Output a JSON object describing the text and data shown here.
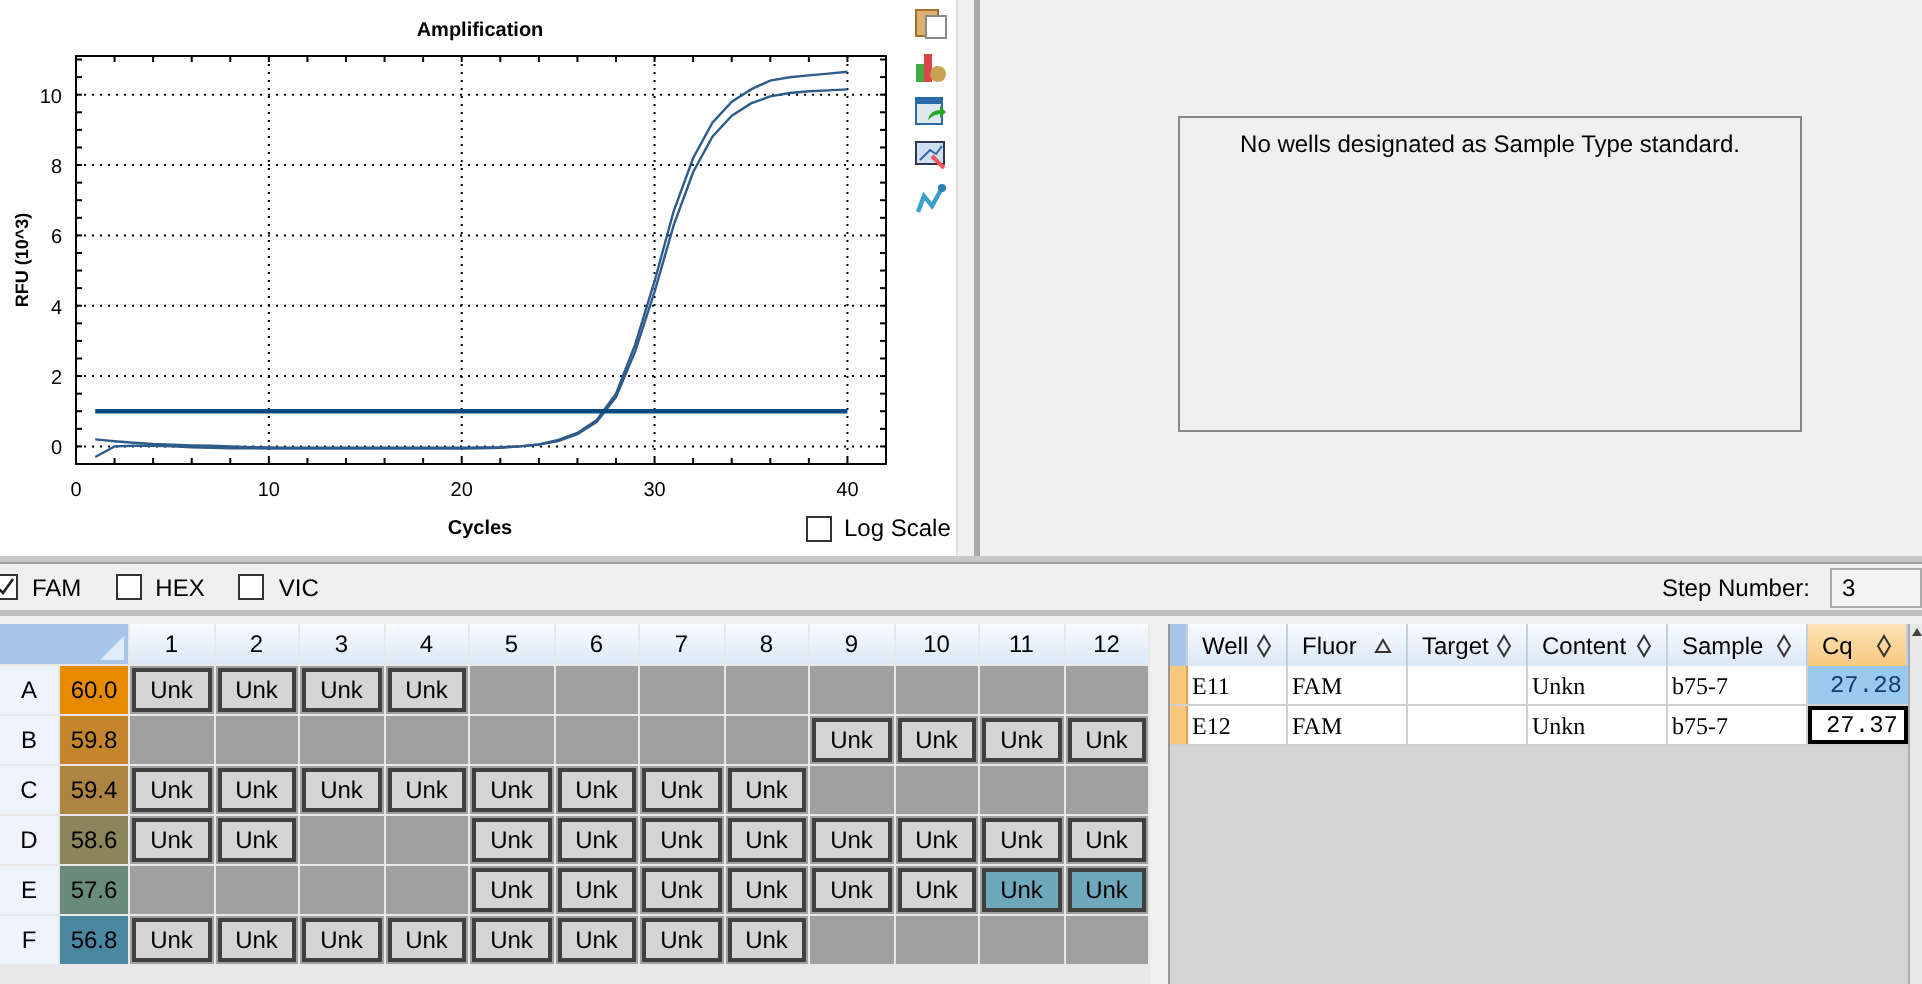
{
  "chart": {
    "chart_data": {
      "type": "line",
      "title": "Amplification",
      "xlabel": "Cycles",
      "ylabel": "RFU (10^3)",
      "x": [
        1,
        2,
        3,
        4,
        5,
        6,
        7,
        8,
        9,
        10,
        11,
        12,
        13,
        14,
        15,
        16,
        17,
        18,
        19,
        20,
        21,
        22,
        23,
        24,
        25,
        26,
        27,
        28,
        29,
        30,
        31,
        32,
        33,
        34,
        35,
        36,
        37,
        38,
        39,
        40
      ],
      "xlim": [
        0,
        42
      ],
      "ylim": [
        -0.5,
        11.1
      ],
      "xticks": [
        0,
        10,
        20,
        30,
        40
      ],
      "yticks": [
        0,
        2,
        4,
        6,
        8,
        10
      ],
      "grid": true,
      "series": [
        {
          "color": "#2e5c8a",
          "values": [
            -0.3,
            0.0,
            0.02,
            0.02,
            0.0,
            -0.02,
            -0.04,
            -0.05,
            -0.05,
            -0.06,
            -0.06,
            -0.06,
            -0.06,
            -0.06,
            -0.06,
            -0.06,
            -0.06,
            -0.06,
            -0.06,
            -0.06,
            -0.05,
            -0.04,
            0.0,
            0.06,
            0.18,
            0.38,
            0.75,
            1.5,
            2.9,
            4.7,
            6.7,
            8.2,
            9.2,
            9.8,
            10.15,
            10.4,
            10.5,
            10.55,
            10.6,
            10.65
          ]
        },
        {
          "color": "#2e5c8a",
          "values": [
            0.2,
            0.15,
            0.1,
            0.07,
            0.05,
            0.03,
            0.02,
            0.0,
            -0.02,
            -0.03,
            -0.04,
            -0.04,
            -0.04,
            -0.04,
            -0.04,
            -0.04,
            -0.04,
            -0.04,
            -0.04,
            -0.04,
            -0.03,
            -0.02,
            0.0,
            0.05,
            0.15,
            0.35,
            0.7,
            1.4,
            2.7,
            4.4,
            6.3,
            7.8,
            8.8,
            9.4,
            9.75,
            9.95,
            10.05,
            10.1,
            10.12,
            10.15
          ]
        },
        {
          "color": "#0b4a80",
          "values": [
            1,
            1,
            1,
            1,
            1,
            1,
            1,
            1,
            1,
            1,
            1,
            1,
            1,
            1,
            1,
            1,
            1,
            1,
            1,
            1,
            1,
            1,
            1,
            1,
            1,
            1,
            1,
            1,
            1,
            1,
            1,
            1,
            1,
            1,
            1,
            1,
            1,
            1,
            1,
            1
          ]
        }
      ]
    },
    "log_scale": {
      "label": "Log Scale",
      "checked": false
    }
  },
  "standard_curve": {
    "message": "No wells designated as Sample Type standard."
  },
  "fluors": [
    {
      "label": "FAM",
      "checked": true
    },
    {
      "label": "HEX",
      "checked": false
    },
    {
      "label": "VIC",
      "checked": false
    }
  ],
  "step_number": {
    "label": "Step Number:",
    "value": "3"
  },
  "plate": {
    "columns": [
      "1",
      "2",
      "3",
      "4",
      "5",
      "6",
      "7",
      "8",
      "9",
      "10",
      "11",
      "12"
    ],
    "rows": [
      {
        "label": "A",
        "temperature": "60.0",
        "color": "#e68a00",
        "wells": [
          {
            "kind": "unk",
            "text": "Unk",
            "selected": false
          },
          {
            "kind": "unk",
            "text": "Unk",
            "selected": false
          },
          {
            "kind": "unk",
            "text": "Unk",
            "selected": false
          },
          {
            "kind": "unk",
            "text": "Unk",
            "selected": false
          },
          {
            "kind": "empty",
            "selected": false
          },
          {
            "kind": "empty",
            "selected": false
          },
          {
            "kind": "empty",
            "selected": false
          },
          {
            "kind": "empty",
            "selected": false
          },
          {
            "kind": "empty",
            "selected": false
          },
          {
            "kind": "empty",
            "selected": false
          },
          {
            "kind": "empty",
            "selected": false
          },
          {
            "kind": "empty",
            "selected": false
          }
        ]
      },
      {
        "label": "B",
        "temperature": "59.8",
        "color": "#c4862c",
        "wells": [
          {
            "kind": "empty",
            "selected": false
          },
          {
            "kind": "empty",
            "selected": false
          },
          {
            "kind": "empty",
            "selected": false
          },
          {
            "kind": "empty",
            "selected": false
          },
          {
            "kind": "empty",
            "selected": false
          },
          {
            "kind": "empty",
            "selected": false
          },
          {
            "kind": "empty",
            "selected": false
          },
          {
            "kind": "empty",
            "selected": false
          },
          {
            "kind": "unk",
            "text": "Unk",
            "selected": false
          },
          {
            "kind": "unk",
            "text": "Unk",
            "selected": false
          },
          {
            "kind": "unk",
            "text": "Unk",
            "selected": false
          },
          {
            "kind": "unk",
            "text": "Unk",
            "selected": false
          }
        ]
      },
      {
        "label": "C",
        "temperature": "59.4",
        "color": "#ad8442",
        "wells": [
          {
            "kind": "unk",
            "text": "Unk",
            "selected": false
          },
          {
            "kind": "unk",
            "text": "Unk",
            "selected": false
          },
          {
            "kind": "unk",
            "text": "Unk",
            "selected": false
          },
          {
            "kind": "unk",
            "text": "Unk",
            "selected": false
          },
          {
            "kind": "unk",
            "text": "Unk",
            "selected": false
          },
          {
            "kind": "unk",
            "text": "Unk",
            "selected": false
          },
          {
            "kind": "unk",
            "text": "Unk",
            "selected": false
          },
          {
            "kind": "unk",
            "text": "Unk",
            "selected": false
          },
          {
            "kind": "empty",
            "selected": false
          },
          {
            "kind": "empty",
            "selected": false
          },
          {
            "kind": "empty",
            "selected": false
          },
          {
            "kind": "empty",
            "selected": false
          }
        ]
      },
      {
        "label": "D",
        "temperature": "58.6",
        "color": "#8c845a",
        "wells": [
          {
            "kind": "unk",
            "text": "Unk",
            "selected": false
          },
          {
            "kind": "unk",
            "text": "Unk",
            "selected": false
          },
          {
            "kind": "empty",
            "selected": false
          },
          {
            "kind": "empty",
            "selected": false
          },
          {
            "kind": "unk",
            "text": "Unk",
            "selected": false
          },
          {
            "kind": "unk",
            "text": "Unk",
            "selected": false
          },
          {
            "kind": "unk",
            "text": "Unk",
            "selected": false
          },
          {
            "kind": "unk",
            "text": "Unk",
            "selected": false
          },
          {
            "kind": "unk",
            "text": "Unk",
            "selected": false
          },
          {
            "kind": "unk",
            "text": "Unk",
            "selected": false
          },
          {
            "kind": "unk",
            "text": "Unk",
            "selected": false
          },
          {
            "kind": "unk",
            "text": "Unk",
            "selected": false
          }
        ]
      },
      {
        "label": "E",
        "temperature": "57.6",
        "color": "#6a8a7c",
        "wells": [
          {
            "kind": "empty",
            "selected": false
          },
          {
            "kind": "empty",
            "selected": false
          },
          {
            "kind": "empty",
            "selected": false
          },
          {
            "kind": "empty",
            "selected": false
          },
          {
            "kind": "unk",
            "text": "Unk",
            "selected": false
          },
          {
            "kind": "unk",
            "text": "Unk",
            "selected": false
          },
          {
            "kind": "unk",
            "text": "Unk",
            "selected": false
          },
          {
            "kind": "unk",
            "text": "Unk",
            "selected": false
          },
          {
            "kind": "unk",
            "text": "Unk",
            "selected": false
          },
          {
            "kind": "unk",
            "text": "Unk",
            "selected": false
          },
          {
            "kind": "unk",
            "text": "Unk",
            "selected": true
          },
          {
            "kind": "unk",
            "text": "Unk",
            "selected": true
          }
        ]
      },
      {
        "label": "F",
        "temperature": "56.8",
        "color": "#4a88a2",
        "wells": [
          {
            "kind": "unk",
            "text": "Unk",
            "selected": false
          },
          {
            "kind": "unk",
            "text": "Unk",
            "selected": false
          },
          {
            "kind": "unk",
            "text": "Unk",
            "selected": false
          },
          {
            "kind": "unk",
            "text": "Unk",
            "selected": false
          },
          {
            "kind": "unk",
            "text": "Unk",
            "selected": false
          },
          {
            "kind": "unk",
            "text": "Unk",
            "selected": false
          },
          {
            "kind": "unk",
            "text": "Unk",
            "selected": false
          },
          {
            "kind": "unk",
            "text": "Unk",
            "selected": false
          },
          {
            "kind": "empty",
            "selected": false
          },
          {
            "kind": "empty",
            "selected": false
          },
          {
            "kind": "empty",
            "selected": false
          },
          {
            "kind": "empty",
            "selected": false
          }
        ]
      }
    ]
  },
  "results_table": {
    "columns": [
      {
        "label": "Well",
        "sorted": false,
        "selected": false
      },
      {
        "label": "Fluor",
        "sorted": true,
        "selected": false
      },
      {
        "label": "Target",
        "sorted": false,
        "selected": false
      },
      {
        "label": "Content",
        "sorted": false,
        "selected": false
      },
      {
        "label": "Sample",
        "sorted": false,
        "selected": false
      },
      {
        "label": "Cq",
        "sorted": false,
        "selected": true
      }
    ],
    "rows": [
      {
        "well": "E11",
        "fluor": "FAM",
        "content": "Unkn",
        "sample": "b75-7",
        "cq": "27.28",
        "cq_selected": true,
        "cq_focused": false
      },
      {
        "well": "E12",
        "fluor": "FAM",
        "content": "Unkn",
        "sample": "b75-7",
        "cq": "27.37",
        "cq_selected": false,
        "cq_focused": true
      }
    ]
  }
}
